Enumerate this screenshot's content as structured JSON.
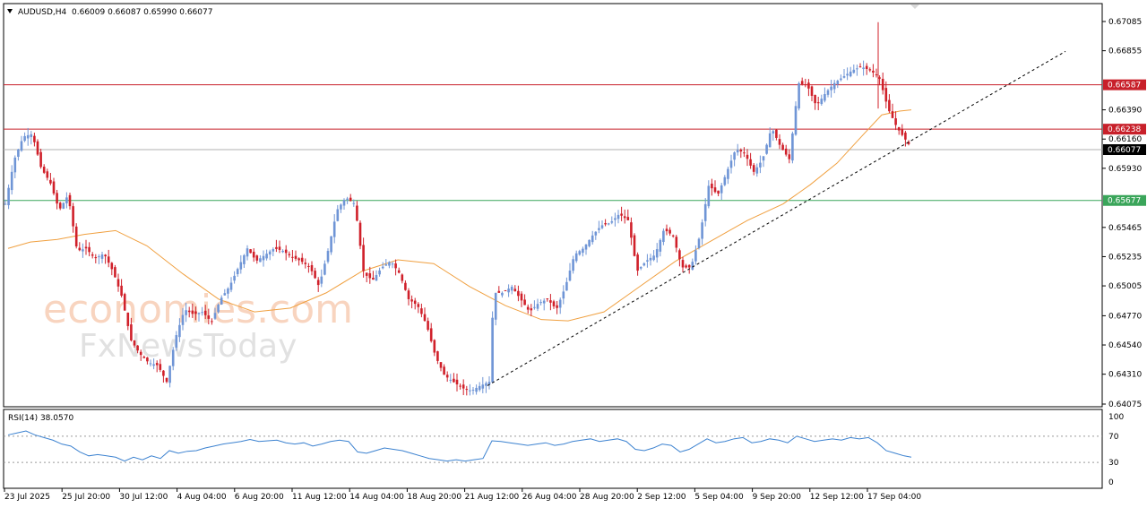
{
  "header": {
    "symbol": "AUDUSD,H4",
    "ohlc": "0.66009 0.66087 0.65990 0.66077"
  },
  "rsi_header": "RSI(14) 38.0570",
  "watermark": {
    "line1": "economies.com",
    "line2": "FxNewsToday"
  },
  "colors": {
    "bull": "#6f95d6",
    "bear": "#d0202a",
    "ma": "#f0a040",
    "resistance": "#c8202a",
    "support": "#3aa55a",
    "rsi": "#3c82d0",
    "grid": "#000000"
  },
  "chart_data": [
    {
      "type": "candlestick",
      "title": "AUDUSD,H4",
      "ylim": [
        0.64075,
        0.67085
      ],
      "y_ticks": [
        "0.67085",
        "0.66855",
        "0.66390",
        "0.66160",
        "0.65930",
        "0.65465",
        "0.65235",
        "0.65005",
        "0.64770",
        "0.64540",
        "0.64310",
        "0.64075"
      ],
      "x_ticks": [
        "23 Jul 2025",
        "25 Jul 20:00",
        "30 Jul 12:00",
        "4 Aug 04:00",
        "6 Aug 20:00",
        "11 Aug 12:00",
        "14 Aug 04:00",
        "18 Aug 20:00",
        "21 Aug 12:00",
        "26 Aug 04:00",
        "28 Aug 20:00",
        "2 Sep 12:00",
        "5 Sep 04:00",
        "9 Sep 20:00",
        "12 Sep 12:00",
        "17 Sep 04:00"
      ],
      "levels": [
        {
          "name": "resistance",
          "value": "0.66587"
        },
        {
          "name": "resistance",
          "value": "0.66238"
        },
        {
          "name": "current",
          "value": "0.66077"
        },
        {
          "name": "support",
          "value": "0.65677"
        }
      ],
      "close_path": [
        [
          0,
          0.6565
        ],
        [
          10,
          0.66
        ],
        [
          20,
          0.6618
        ],
        [
          30,
          0.662
        ],
        [
          40,
          0.6593
        ],
        [
          50,
          0.6582
        ],
        [
          60,
          0.656
        ],
        [
          70,
          0.6572
        ],
        [
          80,
          0.6528
        ],
        [
          90,
          0.653
        ],
        [
          100,
          0.6522
        ],
        [
          110,
          0.6526
        ],
        [
          120,
          0.6512
        ],
        [
          130,
          0.6492
        ],
        [
          140,
          0.6458
        ],
        [
          150,
          0.6447
        ],
        [
          160,
          0.644
        ],
        [
          170,
          0.6438
        ],
        [
          180,
          0.6425
        ],
        [
          190,
          0.646
        ],
        [
          200,
          0.6482
        ],
        [
          210,
          0.6478
        ],
        [
          220,
          0.648
        ],
        [
          230,
          0.6472
        ],
        [
          240,
          0.649
        ],
        [
          250,
          0.65
        ],
        [
          260,
          0.6515
        ],
        [
          270,
          0.653
        ],
        [
          280,
          0.652
        ],
        [
          290,
          0.6525
        ],
        [
          300,
          0.653
        ],
        [
          310,
          0.6528
        ],
        [
          320,
          0.6523
        ],
        [
          330,
          0.652
        ],
        [
          340,
          0.6515
        ],
        [
          350,
          0.65
        ],
        [
          360,
          0.6528
        ],
        [
          370,
          0.656
        ],
        [
          380,
          0.657
        ],
        [
          390,
          0.6565
        ],
        [
          400,
          0.651
        ],
        [
          410,
          0.6505
        ],
        [
          420,
          0.6515
        ],
        [
          430,
          0.652
        ],
        [
          440,
          0.651
        ],
        [
          450,
          0.649
        ],
        [
          460,
          0.6485
        ],
        [
          470,
          0.647
        ],
        [
          480,
          0.6445
        ],
        [
          490,
          0.643
        ],
        [
          500,
          0.6425
        ],
        [
          510,
          0.642
        ],
        [
          520,
          0.6418
        ],
        [
          530,
          0.6422
        ],
        [
          540,
          0.6425
        ],
        [
          545,
          0.6495
        ],
        [
          555,
          0.6495
        ],
        [
          565,
          0.65
        ],
        [
          575,
          0.649
        ],
        [
          585,
          0.648
        ],
        [
          595,
          0.6487
        ],
        [
          605,
          0.649
        ],
        [
          615,
          0.6482
        ],
        [
          625,
          0.65
        ],
        [
          635,
          0.6525
        ],
        [
          645,
          0.653
        ],
        [
          655,
          0.654
        ],
        [
          665,
          0.6548
        ],
        [
          675,
          0.655
        ],
        [
          685,
          0.6557
        ],
        [
          695,
          0.6552
        ],
        [
          705,
          0.6512
        ],
        [
          715,
          0.652
        ],
        [
          725,
          0.6525
        ],
        [
          735,
          0.6545
        ],
        [
          745,
          0.654
        ],
        [
          755,
          0.6515
        ],
        [
          765,
          0.6515
        ],
        [
          775,
          0.654
        ],
        [
          785,
          0.658
        ],
        [
          795,
          0.6572
        ],
        [
          805,
          0.659
        ],
        [
          815,
          0.6608
        ],
        [
          825,
          0.6605
        ],
        [
          835,
          0.659
        ],
        [
          845,
          0.66
        ],
        [
          855,
          0.6625
        ],
        [
          865,
          0.661
        ],
        [
          875,
          0.66
        ],
        [
          885,
          0.666
        ],
        [
          895,
          0.6658
        ],
        [
          905,
          0.6642
        ],
        [
          915,
          0.6652
        ],
        [
          925,
          0.666
        ],
        [
          935,
          0.6665
        ],
        [
          945,
          0.667
        ],
        [
          955,
          0.6673
        ],
        [
          965,
          0.667
        ],
        [
          975,
          0.6665
        ],
        [
          985,
          0.664
        ],
        [
          995,
          0.6625
        ],
        [
          1005,
          0.6615
        ],
        [
          1013,
          0.6607
        ]
      ],
      "ma_path": [
        [
          5,
          0.653
        ],
        [
          30,
          0.6535
        ],
        [
          60,
          0.6537
        ],
        [
          90,
          0.6541
        ],
        [
          125,
          0.6544
        ],
        [
          160,
          0.6532
        ],
        [
          200,
          0.651
        ],
        [
          240,
          0.649
        ],
        [
          280,
          0.648
        ],
        [
          320,
          0.6483
        ],
        [
          360,
          0.6495
        ],
        [
          400,
          0.6512
        ],
        [
          440,
          0.6521
        ],
        [
          480,
          0.6518
        ],
        [
          520,
          0.65
        ],
        [
          560,
          0.6485
        ],
        [
          600,
          0.6474
        ],
        [
          630,
          0.6473
        ],
        [
          670,
          0.648
        ],
        [
          710,
          0.65
        ],
        [
          750,
          0.652
        ],
        [
          790,
          0.6536
        ],
        [
          830,
          0.6552
        ],
        [
          870,
          0.6565
        ],
        [
          900,
          0.658
        ],
        [
          930,
          0.6597
        ],
        [
          960,
          0.662
        ],
        [
          980,
          0.6635
        ],
        [
          1000,
          0.6638
        ],
        [
          1013,
          0.6639
        ]
      ],
      "trendline": [
        [
          540,
          0.6422
        ],
        [
          1185,
          0.6685
        ]
      ]
    },
    {
      "type": "line",
      "title": "RSI(14) 38.0570",
      "ylim": [
        0,
        100
      ],
      "y_ticks": [
        "100",
        "70",
        "30",
        "0"
      ],
      "levels": [
        70,
        30
      ],
      "series": [
        {
          "values": [
            [
              5,
              72
            ],
            [
              15,
              75
            ],
            [
              25,
              78
            ],
            [
              35,
              72
            ],
            [
              45,
              68
            ],
            [
              55,
              64
            ],
            [
              65,
              58
            ],
            [
              75,
              55
            ],
            [
              85,
              46
            ],
            [
              95,
              40
            ],
            [
              105,
              42
            ],
            [
              115,
              40
            ],
            [
              125,
              38
            ],
            [
              135,
              32
            ],
            [
              145,
              38
            ],
            [
              155,
              34
            ],
            [
              165,
              40
            ],
            [
              175,
              36
            ],
            [
              185,
              48
            ],
            [
              195,
              44
            ],
            [
              205,
              47
            ],
            [
              215,
              48
            ],
            [
              225,
              52
            ],
            [
              235,
              55
            ],
            [
              245,
              58
            ],
            [
              255,
              60
            ],
            [
              265,
              62
            ],
            [
              275,
              65
            ],
            [
              285,
              62
            ],
            [
              295,
              63
            ],
            [
              305,
              64
            ],
            [
              315,
              60
            ],
            [
              325,
              58
            ],
            [
              335,
              60
            ],
            [
              345,
              55
            ],
            [
              355,
              58
            ],
            [
              365,
              62
            ],
            [
              375,
              64
            ],
            [
              385,
              62
            ],
            [
              395,
              46
            ],
            [
              405,
              44
            ],
            [
              415,
              48
            ],
            [
              425,
              52
            ],
            [
              435,
              50
            ],
            [
              445,
              48
            ],
            [
              455,
              44
            ],
            [
              465,
              40
            ],
            [
              475,
              36
            ],
            [
              485,
              34
            ],
            [
              495,
              32
            ],
            [
              505,
              34
            ],
            [
              515,
              32
            ],
            [
              525,
              34
            ],
            [
              535,
              36
            ],
            [
              545,
              63
            ],
            [
              555,
              62
            ],
            [
              565,
              60
            ],
            [
              575,
              58
            ],
            [
              585,
              56
            ],
            [
              595,
              58
            ],
            [
              605,
              60
            ],
            [
              615,
              56
            ],
            [
              625,
              58
            ],
            [
              635,
              62
            ],
            [
              645,
              64
            ],
            [
              655,
              66
            ],
            [
              665,
              62
            ],
            [
              675,
              64
            ],
            [
              685,
              66
            ],
            [
              695,
              62
            ],
            [
              705,
              50
            ],
            [
              715,
              48
            ],
            [
              725,
              52
            ],
            [
              735,
              58
            ],
            [
              745,
              56
            ],
            [
              755,
              46
            ],
            [
              765,
              50
            ],
            [
              775,
              58
            ],
            [
              785,
              66
            ],
            [
              795,
              60
            ],
            [
              805,
              62
            ],
            [
              815,
              66
            ],
            [
              825,
              68
            ],
            [
              835,
              60
            ],
            [
              845,
              62
            ],
            [
              855,
              66
            ],
            [
              865,
              64
            ],
            [
              875,
              60
            ],
            [
              885,
              70
            ],
            [
              895,
              66
            ],
            [
              905,
              62
            ],
            [
              915,
              64
            ],
            [
              925,
              66
            ],
            [
              935,
              64
            ],
            [
              945,
              68
            ],
            [
              955,
              66
            ],
            [
              965,
              68
            ],
            [
              975,
              60
            ],
            [
              985,
              48
            ],
            [
              995,
              44
            ],
            [
              1005,
              40
            ],
            [
              1013,
              38
            ]
          ]
        }
      ]
    }
  ]
}
